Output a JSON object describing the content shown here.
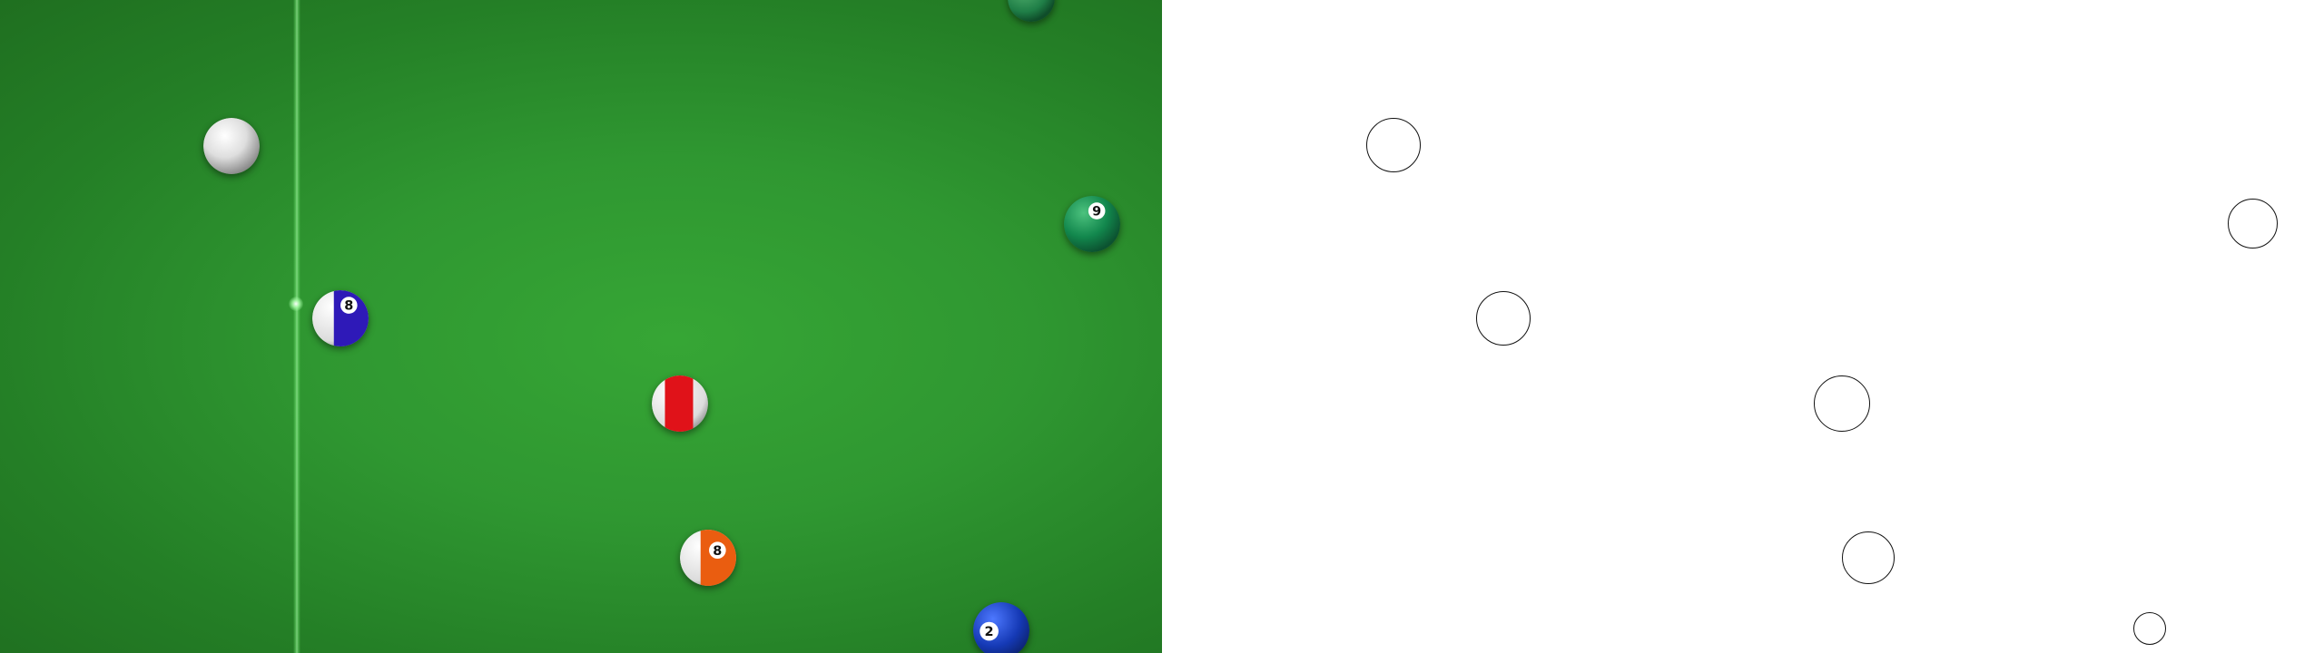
{
  "table": {
    "felt_color": "#2f9731",
    "head_string_color": "#8cff8c"
  },
  "balls": [
    {
      "id": "cue",
      "type": "cue",
      "color": "#e8e8e8"
    },
    {
      "id": "eight",
      "type": "solid",
      "number": "9",
      "color": "#12874d"
    },
    {
      "id": "blue-stripe",
      "type": "stripe",
      "number": "8",
      "color": "#2e19b8"
    },
    {
      "id": "red-stripe",
      "type": "stripe",
      "number": "",
      "color": "#e01219"
    },
    {
      "id": "orange-stripe",
      "type": "stripe",
      "number": "8",
      "color": "#ea5d10"
    },
    {
      "id": "blue-solid",
      "type": "solid",
      "number": "2",
      "color": "#1539b5"
    }
  ]
}
